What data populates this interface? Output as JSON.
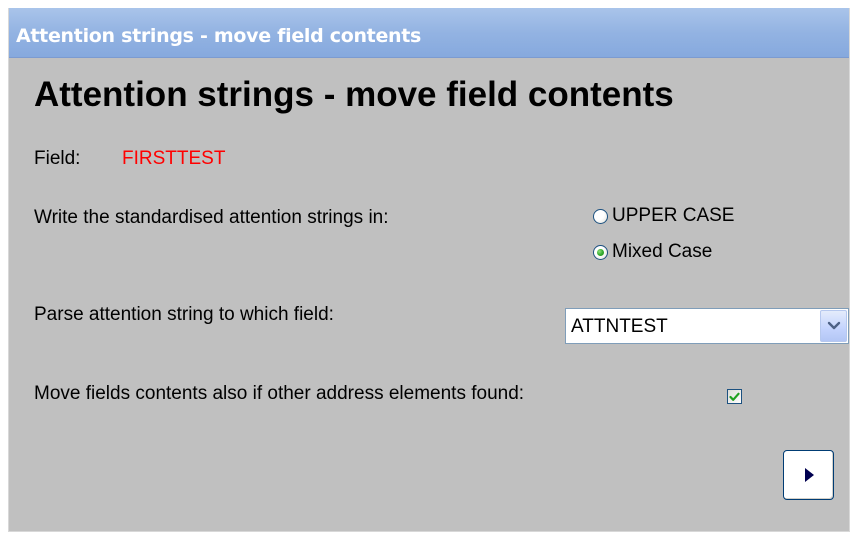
{
  "window": {
    "title": "Attention strings - move field contents"
  },
  "heading": "Attention strings - move field contents",
  "field": {
    "label": "Field:",
    "value": "FIRSTTEST",
    "value_color": "#ff0000"
  },
  "case_option": {
    "label": "Write the standardised attention strings in:",
    "options": [
      {
        "label": "UPPER CASE",
        "selected": false
      },
      {
        "label": "Mixed Case",
        "selected": true
      }
    ]
  },
  "parse_field": {
    "label": "Parse attention string to which field:",
    "selected": "ATTNTEST"
  },
  "move_contents": {
    "label": "Move fields contents also if other address elements found:",
    "checked": true
  },
  "icons": {
    "dropdown": "chevron-down-icon",
    "next": "play-icon",
    "check": "checkmark-icon"
  },
  "colors": {
    "titlebar": "#93b3e2",
    "background": "#c0c0c0",
    "radio_selected": "#31a82c",
    "check": "#21a121",
    "accent_border": "#003c74"
  }
}
